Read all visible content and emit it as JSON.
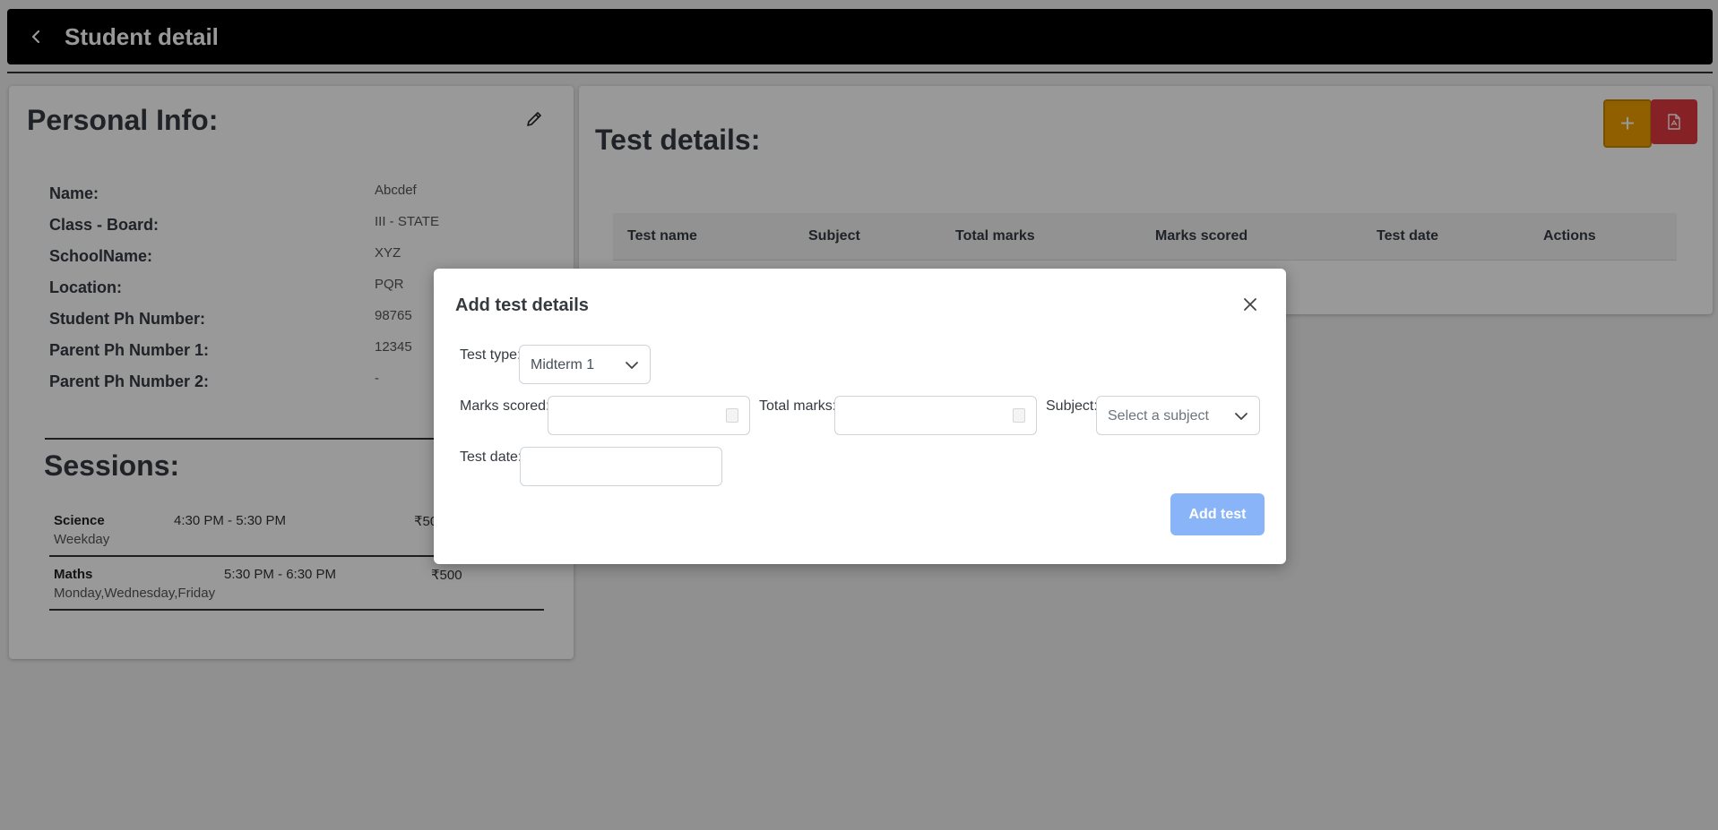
{
  "header": {
    "title": "Student detail"
  },
  "personal": {
    "title": "Personal Info:",
    "fields": [
      {
        "label": "Name:",
        "value": "Abcdef"
      },
      {
        "label": "Class - Board:",
        "value": "III - STATE"
      },
      {
        "label": "SchoolName:",
        "value": "XYZ"
      },
      {
        "label": "Location:",
        "value": "PQR"
      },
      {
        "label": "Student Ph Number:",
        "value": "98765"
      },
      {
        "label": "Parent Ph Number 1:",
        "value": "12345"
      },
      {
        "label": "Parent Ph Number 2:",
        "value": "-"
      }
    ]
  },
  "sessions": {
    "title": "Sessions:",
    "items": [
      {
        "subject": "Science",
        "time": "4:30 PM - 5:30 PM",
        "price": "₹500",
        "days": "Weekday"
      },
      {
        "subject": "Maths",
        "time": "5:30 PM - 6:30 PM",
        "price": "₹500",
        "days": "Monday,Wednesday,Friday"
      }
    ]
  },
  "tests": {
    "title": "Test details:",
    "add_icon": "plus-icon",
    "pdf_icon": "pdf-file-icon",
    "columns": [
      "Test name",
      "Subject",
      "Total marks",
      "Marks scored",
      "Test date",
      "Actions"
    ]
  },
  "modal": {
    "title": "Add test details",
    "test_type_label": "Test type:",
    "test_type_value": "Midterm 1",
    "marks_scored_label": "Marks scored:",
    "total_marks_label": "Total marks:",
    "subject_label": "Subject:",
    "subject_placeholder": "Select a subject",
    "test_date_label": "Test date:",
    "submit_label": "Add test"
  },
  "colors": {
    "add_button": "#f0a000",
    "pdf_button": "#e03a3e",
    "submit_button": "#8ab4f8"
  }
}
